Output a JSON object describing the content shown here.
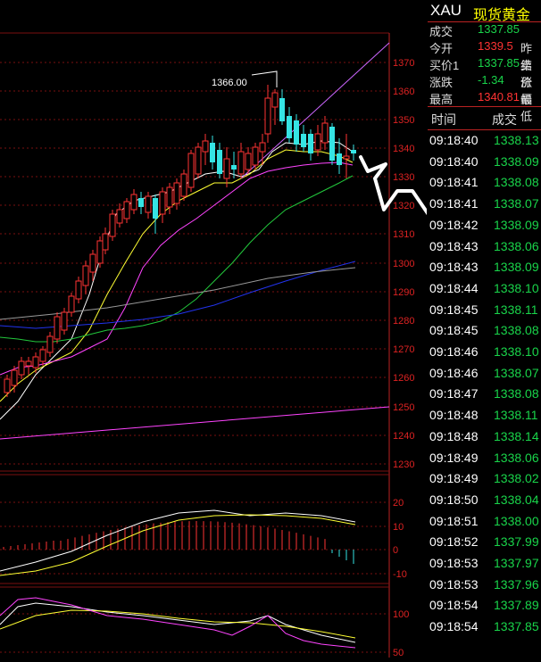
{
  "header": {
    "symbol": "XAU",
    "name": "现货黄金"
  },
  "quote": {
    "rows": [
      {
        "label": "成交",
        "value": "1337.85",
        "color": "#19d44a",
        "label2": ""
      },
      {
        "label": "今开",
        "value": "1339.5",
        "color": "#ff3333",
        "label2": "昨结"
      },
      {
        "label": "买价1",
        "value": "1337.85",
        "color": "#19d44a",
        "label2": "卖价"
      },
      {
        "label": "涨跌",
        "value": "-1.34",
        "color": "#19d44a",
        "label2": "涨幅"
      },
      {
        "label": "最高",
        "value": "1340.81",
        "color": "#ff3333",
        "label2": "最低"
      }
    ]
  },
  "ticks": {
    "header_time": "时间",
    "header_price": "成交",
    "rows": [
      {
        "time": "09:18:40",
        "price": "1338.13"
      },
      {
        "time": "09:18:40",
        "price": "1338.09"
      },
      {
        "time": "09:18:41",
        "price": "1338.08"
      },
      {
        "time": "09:18:41",
        "price": "1338.07"
      },
      {
        "time": "09:18:42",
        "price": "1338.09"
      },
      {
        "time": "09:18:43",
        "price": "1338.06"
      },
      {
        "time": "09:18:43",
        "price": "1338.09"
      },
      {
        "time": "09:18:44",
        "price": "1338.10"
      },
      {
        "time": "09:18:45",
        "price": "1338.11"
      },
      {
        "time": "09:18:45",
        "price": "1338.08"
      },
      {
        "time": "09:18:46",
        "price": "1338.10"
      },
      {
        "time": "09:18:46",
        "price": "1338.07"
      },
      {
        "time": "09:18:47",
        "price": "1338.08"
      },
      {
        "time": "09:18:48",
        "price": "1338.11"
      },
      {
        "time": "09:18:48",
        "price": "1338.14"
      },
      {
        "time": "09:18:49",
        "price": "1338.06"
      },
      {
        "time": "09:18:49",
        "price": "1338.02"
      },
      {
        "time": "09:18:50",
        "price": "1338.04"
      },
      {
        "time": "09:18:51",
        "price": "1338.00"
      },
      {
        "time": "09:18:52",
        "price": "1337.99"
      },
      {
        "time": "09:18:53",
        "price": "1337.97"
      },
      {
        "time": "09:18:53",
        "price": "1337.96"
      },
      {
        "time": "09:18:54",
        "price": "1337.89"
      },
      {
        "time": "09:18:54",
        "price": "1337.85"
      }
    ]
  },
  "chart": {
    "price_axis": [
      "1370",
      "1360",
      "1350",
      "1340",
      "1330",
      "1320",
      "1310",
      "1300",
      "1290",
      "1280",
      "1270",
      "1260",
      "1250",
      "1240",
      "1230"
    ],
    "high_label": "1366.00",
    "macd_axis": [
      "20",
      "10",
      "0",
      "-10"
    ],
    "kdj_axis": [
      "100",
      "50"
    ],
    "colors": {
      "up": "#ff3333",
      "down": "#35e4e4",
      "grid": "#7a1010",
      "text": "#d22"
    }
  }
}
